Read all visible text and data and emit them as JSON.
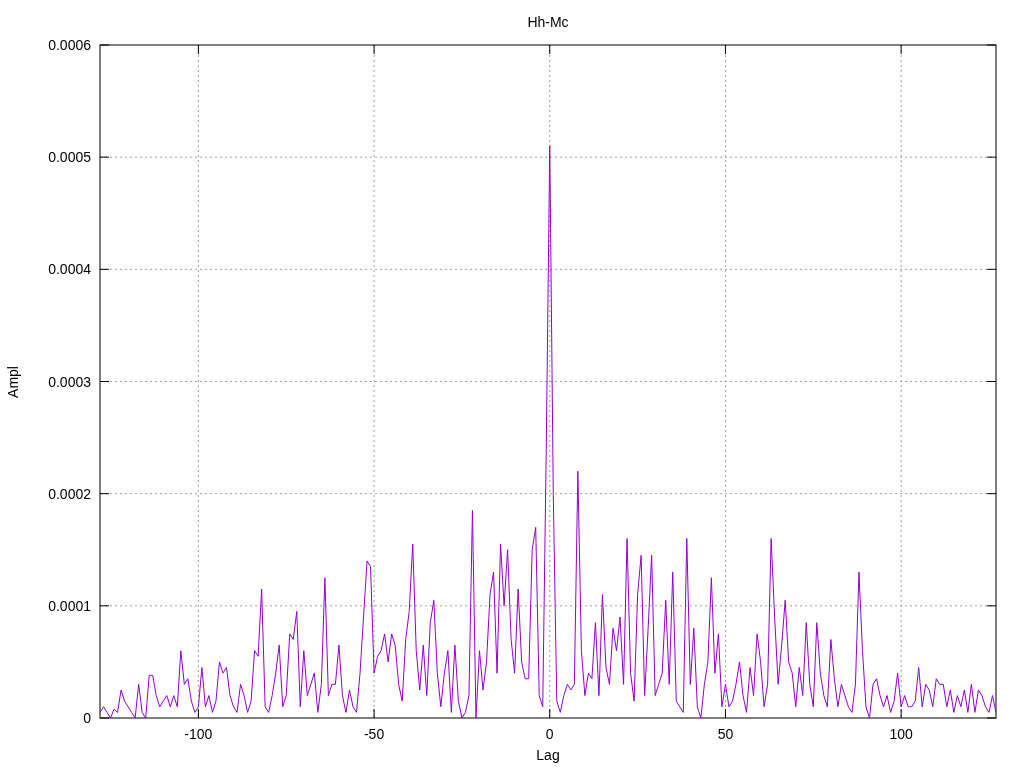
{
  "chart_data": {
    "type": "line",
    "title": "Hh-Mc",
    "xlabel": "Lag",
    "ylabel": "Ampl",
    "grid": true,
    "xlim": [
      -128,
      127
    ],
    "ylim": [
      0,
      0.0006
    ],
    "xticks": [
      -100,
      -50,
      0,
      50,
      100
    ],
    "yticks": [
      0,
      0.0001,
      0.0002,
      0.0003,
      0.0004,
      0.0005,
      0.0006
    ],
    "x": [
      -128,
      -127,
      -126,
      -125,
      -124,
      -123,
      -122,
      -121,
      -120,
      -119,
      -118,
      -117,
      -116,
      -115,
      -114,
      -113,
      -112,
      -111,
      -110,
      -109,
      -108,
      -107,
      -106,
      -105,
      -104,
      -103,
      -102,
      -101,
      -100,
      -99,
      -98,
      -97,
      -96,
      -95,
      -94,
      -93,
      -92,
      -91,
      -90,
      -89,
      -88,
      -87,
      -86,
      -85,
      -84,
      -83,
      -82,
      -81,
      -80,
      -79,
      -78,
      -77,
      -76,
      -75,
      -74,
      -73,
      -72,
      -71,
      -70,
      -69,
      -68,
      -67,
      -66,
      -65,
      -64,
      -63,
      -62,
      -61,
      -60,
      -59,
      -58,
      -57,
      -56,
      -55,
      -54,
      -53,
      -52,
      -51,
      -50,
      -49,
      -48,
      -47,
      -46,
      -45,
      -44,
      -43,
      -42,
      -41,
      -40,
      -39,
      -38,
      -37,
      -36,
      -35,
      -34,
      -33,
      -32,
      -31,
      -30,
      -29,
      -28,
      -27,
      -26,
      -25,
      -24,
      -23,
      -22,
      -21,
      -20,
      -19,
      -18,
      -17,
      -16,
      -15,
      -14,
      -13,
      -12,
      -11,
      -10,
      -9,
      -8,
      -7,
      -6,
      -5,
      -4,
      -3,
      -2,
      -1,
      0,
      1,
      2,
      3,
      4,
      5,
      6,
      7,
      8,
      9,
      10,
      11,
      12,
      13,
      14,
      15,
      16,
      17,
      18,
      19,
      20,
      21,
      22,
      23,
      24,
      25,
      26,
      27,
      28,
      29,
      30,
      31,
      32,
      33,
      34,
      35,
      36,
      37,
      38,
      39,
      40,
      41,
      42,
      43,
      44,
      45,
      46,
      47,
      48,
      49,
      50,
      51,
      52,
      53,
      54,
      55,
      56,
      57,
      58,
      59,
      60,
      61,
      62,
      63,
      64,
      65,
      66,
      67,
      68,
      69,
      70,
      71,
      72,
      73,
      74,
      75,
      76,
      77,
      78,
      79,
      80,
      81,
      82,
      83,
      84,
      85,
      86,
      87,
      88,
      89,
      90,
      91,
      92,
      93,
      94,
      95,
      96,
      97,
      98,
      99,
      100,
      101,
      102,
      103,
      104,
      105,
      106,
      107,
      108,
      109,
      110,
      111,
      112,
      113,
      114,
      115,
      116,
      117,
      118,
      119,
      120,
      121,
      122,
      123,
      124,
      125,
      126,
      127
    ],
    "series": [
      {
        "color": "#9400d3",
        "values": [
          5e-06,
          1e-05,
          5e-06,
          0,
          8e-06,
          5e-06,
          2.5e-05,
          1.5e-05,
          1e-05,
          5e-06,
          0,
          3e-05,
          5e-06,
          0,
          3.8e-05,
          3.8e-05,
          2e-05,
          1e-05,
          1.5e-05,
          2e-05,
          1e-05,
          2e-05,
          1e-05,
          6e-05,
          3e-05,
          3.5e-05,
          1.5e-05,
          5e-06,
          1e-05,
          4.5e-05,
          1e-05,
          2e-05,
          5e-06,
          1.5e-05,
          5e-05,
          4e-05,
          4.5e-05,
          2e-05,
          1e-05,
          5e-06,
          3e-05,
          2e-05,
          5e-06,
          1.5e-05,
          6e-05,
          5.5e-05,
          0.000115,
          1e-05,
          5e-06,
          2e-05,
          4e-05,
          6.5e-05,
          1e-05,
          2e-05,
          7.5e-05,
          7e-05,
          9.5e-05,
          1e-05,
          6e-05,
          2e-05,
          3e-05,
          4e-05,
          5e-06,
          3e-05,
          0.000125,
          2e-05,
          3e-05,
          3e-05,
          6.5e-05,
          2e-05,
          5e-06,
          2.5e-05,
          1e-05,
          5e-06,
          4e-05,
          9e-05,
          0.00014,
          0.000135,
          4e-05,
          5.5e-05,
          6e-05,
          7.5e-05,
          5e-05,
          7.5e-05,
          6.5e-05,
          3e-05,
          1.5e-05,
          7e-05,
          9.5e-05,
          0.000155,
          6e-05,
          2.5e-05,
          6.5e-05,
          2e-05,
          8.5e-05,
          0.000105,
          4e-05,
          1e-05,
          4e-05,
          6e-05,
          5e-06,
          6.5e-05,
          1.5e-05,
          0,
          5e-06,
          2e-05,
          0.000185,
          0,
          6e-05,
          2.5e-05,
          5e-05,
          0.00011,
          0.00013,
          4e-05,
          0.000155,
          0.0001,
          0.00015,
          7e-05,
          4e-05,
          0.000115,
          5e-05,
          3.5e-05,
          3.5e-05,
          0.00015,
          0.00017,
          2e-05,
          1e-05,
          0.00024,
          0.00051,
          0.0002,
          1.5e-05,
          5e-06,
          2e-05,
          3e-05,
          2.5e-05,
          3e-05,
          0.00022,
          6e-05,
          2e-05,
          4e-05,
          3.5e-05,
          8.5e-05,
          2e-05,
          0.00011,
          4.5e-05,
          3e-05,
          8e-05,
          6e-05,
          9e-05,
          3e-05,
          0.00016,
          4e-05,
          1.5e-05,
          0.00011,
          0.000145,
          2e-05,
          8e-05,
          0.000145,
          2e-05,
          3e-05,
          4e-05,
          0.000105,
          3e-05,
          0.00013,
          1.5e-05,
          1e-05,
          5e-06,
          0.00016,
          3e-05,
          8e-05,
          1e-05,
          0,
          3e-05,
          5e-05,
          0.000125,
          4e-05,
          7.5e-05,
          1e-05,
          3e-05,
          1e-05,
          1.5e-05,
          3e-05,
          5e-05,
          2e-05,
          5e-06,
          4.5e-05,
          2e-05,
          7.5e-05,
          5e-05,
          1e-05,
          3e-05,
          0.00016,
          9e-05,
          3e-05,
          6.5e-05,
          0.000105,
          5e-05,
          4e-05,
          1e-05,
          4.5e-05,
          2e-05,
          8.5e-05,
          3e-05,
          1e-05,
          8.5e-05,
          4e-05,
          2e-05,
          1e-05,
          7e-05,
          3.5e-05,
          1e-05,
          3e-05,
          2e-05,
          1e-05,
          5e-06,
          3e-05,
          0.00013,
          6e-05,
          1e-05,
          0,
          3e-05,
          3.5e-05,
          2e-05,
          1e-05,
          2e-05,
          5e-06,
          1.5e-05,
          4e-05,
          1e-05,
          2e-05,
          1e-05,
          1e-05,
          1.5e-05,
          4.5e-05,
          1e-05,
          3e-05,
          2.5e-05,
          1e-05,
          3.5e-05,
          3e-05,
          3e-05,
          1e-05,
          2.5e-05,
          5e-06,
          2e-05,
          1e-05,
          2.5e-05,
          5e-06,
          3e-05,
          5e-06,
          2.5e-05,
          2e-05,
          1e-05,
          5e-06,
          2e-05,
          5e-06
        ]
      }
    ]
  }
}
